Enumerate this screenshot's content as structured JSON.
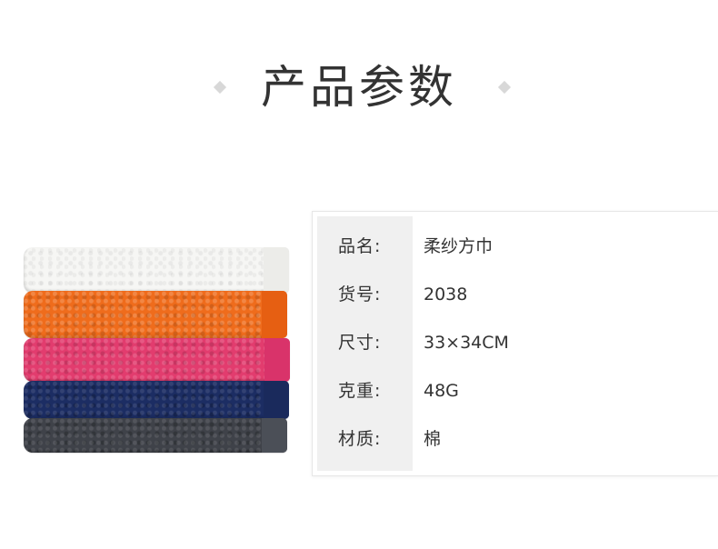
{
  "title": "产品参数",
  "product_image": {
    "icon": "stacked-towels-image",
    "towel_colors": [
      "#f6f6f4",
      "#ef6c1c",
      "#e23c6e",
      "#1c2d63",
      "#3f4249"
    ]
  },
  "specs": [
    {
      "label": "品名:",
      "value": "柔纱方巾"
    },
    {
      "label": "货号:",
      "value": "2038"
    },
    {
      "label": "尺寸:",
      "value": "33×34CM"
    },
    {
      "label": "克重:",
      "value": "48G"
    },
    {
      "label": "材质:",
      "value": "棉"
    }
  ]
}
